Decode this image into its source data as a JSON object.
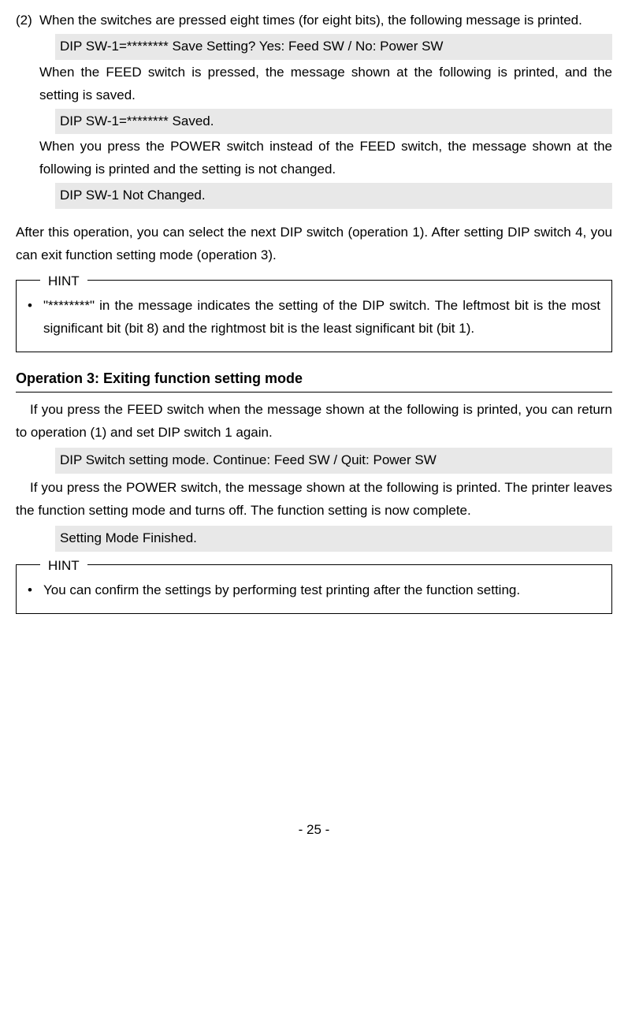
{
  "step2": {
    "num": "(2)",
    "intro": "When the switches are pressed eight times (for eight bits), the following message is printed.",
    "msg1": "DIP SW-1=******** Save Setting?    Yes: Feed SW / No: Power SW",
    "para2": "When the FEED switch is pressed, the message shown at the following is printed, and the setting is saved.",
    "msg2": "DIP SW-1=******** Saved.",
    "para3": "When you press the POWER switch instead of the FEED switch, the message shown at the following is printed and the setting is not changed.",
    "msg3": "DIP SW-1 Not Changed."
  },
  "after_para": "After this operation, you can select the next DIP switch (operation 1). After setting DIP switch 4, you can exit function setting mode (operation 3).",
  "hint1": {
    "label": "HINT",
    "text": "\"********\" in the message indicates the setting of the DIP switch.  The leftmost bit is the most significant bit (bit 8) and the rightmost bit is the least significant bit (bit 1)."
  },
  "op3": {
    "heading": "Operation 3: Exiting function setting mode",
    "para1": "If you press the FEED switch when the message shown at the following is printed,   you can return to operation (1) and set DIP switch 1 again.",
    "msg1": "DIP Switch setting mode.      Continue: Feed SW / Quit: Power SW",
    "para2": "If you press the POWER switch, the message shown at the following is printed. The printer leaves the function setting mode and turns off.  The function setting is now complete.",
    "msg2": "Setting Mode Finished."
  },
  "hint2": {
    "label": "HINT",
    "text": "You can confirm the settings by performing test printing after the function setting."
  },
  "page": "- 25 -"
}
